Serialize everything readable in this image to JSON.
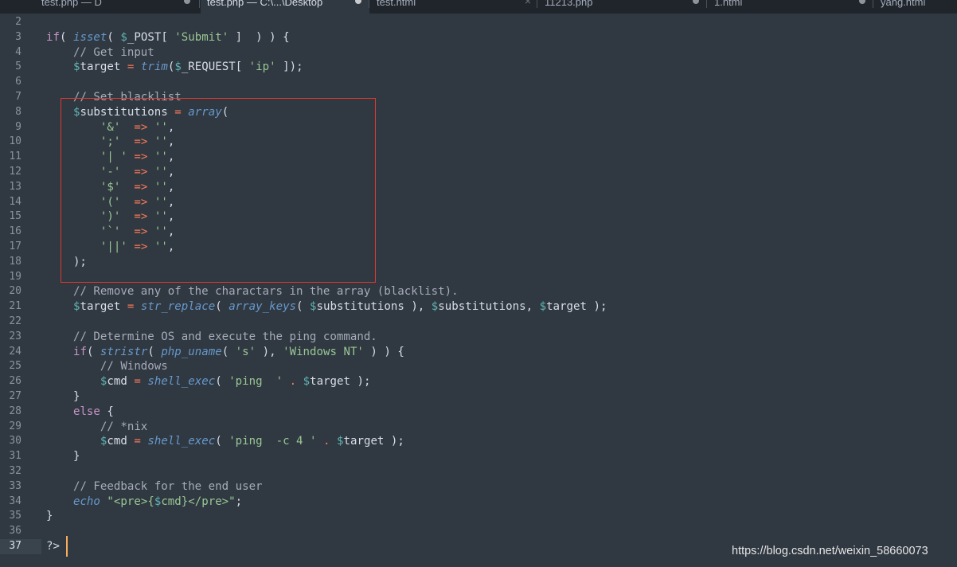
{
  "tabs": [
    {
      "label": "test.php — D",
      "state": "dirty"
    },
    {
      "label": "test.php — C:\\...\\Desktop",
      "state": "dirty",
      "active": true
    },
    {
      "label": "test.html",
      "state": "close"
    },
    {
      "label": "11213.php",
      "state": "dirty"
    },
    {
      "label": "1.html",
      "state": "dirty"
    },
    {
      "label": "yang.html",
      "state": "none"
    }
  ],
  "editor": {
    "current_line": "37",
    "lines": [
      {
        "n": "2",
        "tokens": []
      },
      {
        "n": "3",
        "tokens": [
          [
            "kw",
            "if"
          ],
          [
            "pl",
            "( "
          ],
          [
            "fn",
            "isset"
          ],
          [
            "pl",
            "( "
          ],
          [
            "dollar",
            "$"
          ],
          [
            "pl",
            "_POST[ "
          ],
          [
            "str",
            "'Submit'"
          ],
          [
            "pl",
            " ]  ) ) {"
          ]
        ]
      },
      {
        "n": "4",
        "tokens": [
          [
            "pl",
            "    "
          ],
          [
            "cm",
            "// Get input"
          ]
        ]
      },
      {
        "n": "5",
        "tokens": [
          [
            "pl",
            "    "
          ],
          [
            "dollar",
            "$"
          ],
          [
            "pl",
            "target "
          ],
          [
            "op",
            "="
          ],
          [
            "pl",
            " "
          ],
          [
            "fn",
            "trim"
          ],
          [
            "pl",
            "("
          ],
          [
            "dollar",
            "$"
          ],
          [
            "pl",
            "_REQUEST[ "
          ],
          [
            "str",
            "'ip'"
          ],
          [
            "pl",
            " ]);"
          ]
        ]
      },
      {
        "n": "6",
        "tokens": []
      },
      {
        "n": "7",
        "tokens": [
          [
            "pl",
            "    "
          ],
          [
            "cm",
            "// Set blacklist"
          ]
        ]
      },
      {
        "n": "8",
        "tokens": [
          [
            "pl",
            "    "
          ],
          [
            "dollar",
            "$"
          ],
          [
            "pl",
            "substitutions "
          ],
          [
            "op",
            "="
          ],
          [
            "pl",
            " "
          ],
          [
            "fn",
            "array"
          ],
          [
            "pl",
            "("
          ]
        ]
      },
      {
        "n": "9",
        "tokens": [
          [
            "pl",
            "        "
          ],
          [
            "str",
            "'&'"
          ],
          [
            "pl",
            "  "
          ],
          [
            "op",
            "=>"
          ],
          [
            "pl",
            " "
          ],
          [
            "str",
            "''"
          ],
          [
            "pl",
            ","
          ]
        ]
      },
      {
        "n": "10",
        "tokens": [
          [
            "pl",
            "        "
          ],
          [
            "str",
            "';'"
          ],
          [
            "pl",
            "  "
          ],
          [
            "op",
            "=>"
          ],
          [
            "pl",
            " "
          ],
          [
            "str",
            "''"
          ],
          [
            "pl",
            ","
          ]
        ]
      },
      {
        "n": "11",
        "tokens": [
          [
            "pl",
            "        "
          ],
          [
            "str",
            "'| '"
          ],
          [
            "pl",
            " "
          ],
          [
            "op",
            "=>"
          ],
          [
            "pl",
            " "
          ],
          [
            "str",
            "''"
          ],
          [
            "pl",
            ","
          ]
        ]
      },
      {
        "n": "12",
        "tokens": [
          [
            "pl",
            "        "
          ],
          [
            "str",
            "'-'"
          ],
          [
            "pl",
            "  "
          ],
          [
            "op",
            "=>"
          ],
          [
            "pl",
            " "
          ],
          [
            "str",
            "''"
          ],
          [
            "pl",
            ","
          ]
        ]
      },
      {
        "n": "13",
        "tokens": [
          [
            "pl",
            "        "
          ],
          [
            "str",
            "'$'"
          ],
          [
            "pl",
            "  "
          ],
          [
            "op",
            "=>"
          ],
          [
            "pl",
            " "
          ],
          [
            "str",
            "''"
          ],
          [
            "pl",
            ","
          ]
        ]
      },
      {
        "n": "14",
        "tokens": [
          [
            "pl",
            "        "
          ],
          [
            "str",
            "'('"
          ],
          [
            "pl",
            "  "
          ],
          [
            "op",
            "=>"
          ],
          [
            "pl",
            " "
          ],
          [
            "str",
            "''"
          ],
          [
            "pl",
            ","
          ]
        ]
      },
      {
        "n": "15",
        "tokens": [
          [
            "pl",
            "        "
          ],
          [
            "str",
            "')'"
          ],
          [
            "pl",
            "  "
          ],
          [
            "op",
            "=>"
          ],
          [
            "pl",
            " "
          ],
          [
            "str",
            "''"
          ],
          [
            "pl",
            ","
          ]
        ]
      },
      {
        "n": "16",
        "tokens": [
          [
            "pl",
            "        "
          ],
          [
            "str",
            "'`'"
          ],
          [
            "pl",
            "  "
          ],
          [
            "op",
            "=>"
          ],
          [
            "pl",
            " "
          ],
          [
            "str",
            "''"
          ],
          [
            "pl",
            ","
          ]
        ]
      },
      {
        "n": "17",
        "tokens": [
          [
            "pl",
            "        "
          ],
          [
            "str",
            "'||'"
          ],
          [
            "pl",
            " "
          ],
          [
            "op",
            "=>"
          ],
          [
            "pl",
            " "
          ],
          [
            "str",
            "''"
          ],
          [
            "pl",
            ","
          ]
        ]
      },
      {
        "n": "18",
        "tokens": [
          [
            "pl",
            "    );"
          ]
        ]
      },
      {
        "n": "19",
        "tokens": []
      },
      {
        "n": "20",
        "tokens": [
          [
            "pl",
            "    "
          ],
          [
            "cm",
            "// Remove any of the charactars in the array (blacklist)."
          ]
        ]
      },
      {
        "n": "21",
        "tokens": [
          [
            "pl",
            "    "
          ],
          [
            "dollar",
            "$"
          ],
          [
            "pl",
            "target "
          ],
          [
            "op",
            "="
          ],
          [
            "pl",
            " "
          ],
          [
            "fn",
            "str_replace"
          ],
          [
            "pl",
            "( "
          ],
          [
            "fn",
            "array_keys"
          ],
          [
            "pl",
            "( "
          ],
          [
            "dollar",
            "$"
          ],
          [
            "pl",
            "substitutions ), "
          ],
          [
            "dollar",
            "$"
          ],
          [
            "pl",
            "substitutions, "
          ],
          [
            "dollar",
            "$"
          ],
          [
            "pl",
            "target );"
          ]
        ]
      },
      {
        "n": "22",
        "tokens": []
      },
      {
        "n": "23",
        "tokens": [
          [
            "pl",
            "    "
          ],
          [
            "cm",
            "// Determine OS and execute the ping command."
          ]
        ]
      },
      {
        "n": "24",
        "tokens": [
          [
            "pl",
            "    "
          ],
          [
            "kw",
            "if"
          ],
          [
            "pl",
            "( "
          ],
          [
            "fn",
            "stristr"
          ],
          [
            "pl",
            "( "
          ],
          [
            "fn",
            "php_uname"
          ],
          [
            "pl",
            "( "
          ],
          [
            "str",
            "'s'"
          ],
          [
            "pl",
            " ), "
          ],
          [
            "str",
            "'Windows NT'"
          ],
          [
            "pl",
            " ) ) {"
          ]
        ]
      },
      {
        "n": "25",
        "tokens": [
          [
            "pl",
            "        "
          ],
          [
            "cm",
            "// Windows"
          ]
        ]
      },
      {
        "n": "26",
        "tokens": [
          [
            "pl",
            "        "
          ],
          [
            "dollar",
            "$"
          ],
          [
            "pl",
            "cmd "
          ],
          [
            "op",
            "="
          ],
          [
            "pl",
            " "
          ],
          [
            "fn",
            "shell_exec"
          ],
          [
            "pl",
            "( "
          ],
          [
            "str",
            "'ping  '"
          ],
          [
            "pl",
            " "
          ],
          [
            "op",
            "."
          ],
          [
            "pl",
            " "
          ],
          [
            "dollar",
            "$"
          ],
          [
            "pl",
            "target );"
          ]
        ]
      },
      {
        "n": "27",
        "tokens": [
          [
            "pl",
            "    }"
          ]
        ]
      },
      {
        "n": "28",
        "tokens": [
          [
            "pl",
            "    "
          ],
          [
            "kw",
            "else"
          ],
          [
            "pl",
            " {"
          ]
        ]
      },
      {
        "n": "29",
        "tokens": [
          [
            "pl",
            "        "
          ],
          [
            "cm",
            "// *nix"
          ]
        ]
      },
      {
        "n": "30",
        "tokens": [
          [
            "pl",
            "        "
          ],
          [
            "dollar",
            "$"
          ],
          [
            "pl",
            "cmd "
          ],
          [
            "op",
            "="
          ],
          [
            "pl",
            " "
          ],
          [
            "fn",
            "shell_exec"
          ],
          [
            "pl",
            "( "
          ],
          [
            "str",
            "'ping  -c 4 '"
          ],
          [
            "pl",
            " "
          ],
          [
            "op",
            "."
          ],
          [
            "pl",
            " "
          ],
          [
            "dollar",
            "$"
          ],
          [
            "pl",
            "target );"
          ]
        ]
      },
      {
        "n": "31",
        "tokens": [
          [
            "pl",
            "    }"
          ]
        ]
      },
      {
        "n": "32",
        "tokens": []
      },
      {
        "n": "33",
        "tokens": [
          [
            "pl",
            "    "
          ],
          [
            "cm",
            "// Feedback for the end user"
          ]
        ]
      },
      {
        "n": "34",
        "tokens": [
          [
            "pl",
            "    "
          ],
          [
            "fn",
            "echo"
          ],
          [
            "pl",
            " "
          ],
          [
            "str",
            "\"<pre>{"
          ],
          [
            "dollar",
            "$"
          ],
          [
            "str",
            "cmd}</pre>\""
          ],
          [
            "pl",
            ";"
          ]
        ]
      },
      {
        "n": "35",
        "tokens": [
          [
            "pl",
            "}"
          ]
        ]
      },
      {
        "n": "36",
        "tokens": []
      },
      {
        "n": "37",
        "tokens": [
          [
            "pl",
            "?>"
          ]
        ]
      }
    ]
  },
  "watermark": "https://blog.csdn.net/weixin_58660073"
}
